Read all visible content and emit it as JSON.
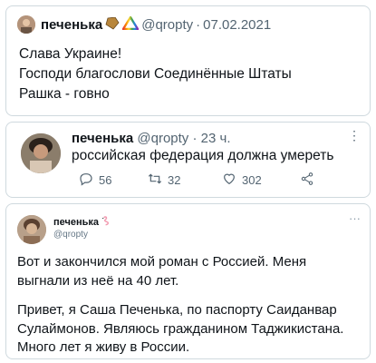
{
  "tweet1": {
    "name": "печенька",
    "emoji_icons": [
      "coffin-icon",
      "pride-triangle-icon"
    ],
    "handle": "@qropty",
    "separator": "·",
    "date": "07.02.2021",
    "lines": [
      "Слава Украине!",
      "Господи благослови Соединённые Штаты",
      "Рашка - говно"
    ]
  },
  "tweet2": {
    "name": "печенька",
    "handle": "@qropty",
    "separator": "·",
    "time": "23 ч.",
    "text": "российская федерация должна умереть",
    "more": "⋮",
    "actions": {
      "replies": "56",
      "retweets": "32",
      "likes": "302"
    }
  },
  "tweet3": {
    "name": "печенька",
    "emoji_icon": "flamingo-icon",
    "handle": "@qropty",
    "more": "···",
    "paragraphs": [
      "Вот и закончился мой роман с Россией. Меня выгнали из неё на 40 лет.",
      "Привет, я Саша Печенька, по паспорту Саиданвар Сулаймонов. Являюсь гражданином Таджикистана. Много лет я живу в России."
    ]
  },
  "colors": {
    "text": "#0f1419",
    "secondary": "#536471",
    "border": "#cfd9de",
    "coffin": "#b8863b",
    "flamingo": "#f29ab0"
  }
}
